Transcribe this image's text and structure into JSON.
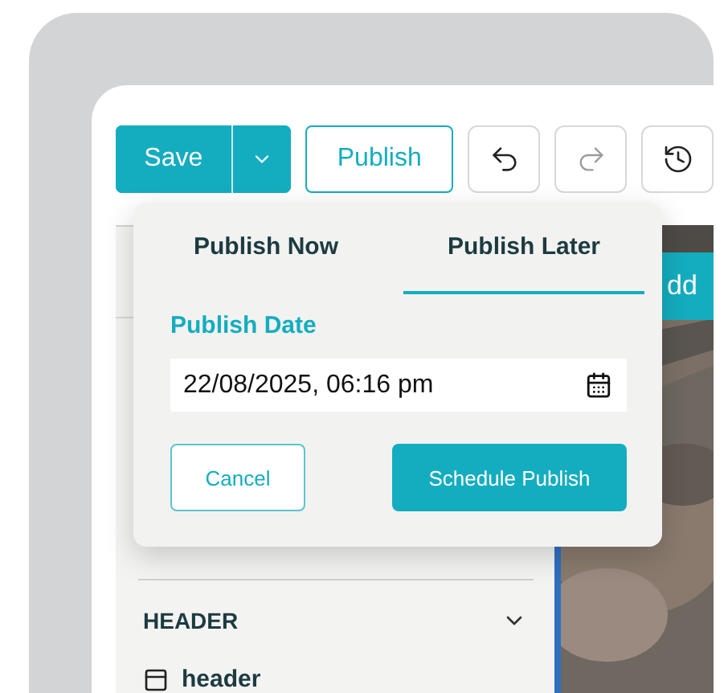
{
  "toolbar": {
    "save_label": "Save",
    "publish_label": "Publish"
  },
  "canvas": {
    "add_button": "dd"
  },
  "sidebar": {
    "section": {
      "title": "HEADER",
      "expanded": true,
      "items": [
        {
          "label": "header"
        }
      ]
    }
  },
  "publish_popup": {
    "tabs": [
      {
        "label": "Publish Now",
        "selected": false
      },
      {
        "label": "Publish Later",
        "selected": true
      }
    ],
    "date_label": "Publish Date",
    "date_value": "22/08/2025, 06:16 pm",
    "cancel": "Cancel",
    "submit": "Schedule Publish"
  }
}
